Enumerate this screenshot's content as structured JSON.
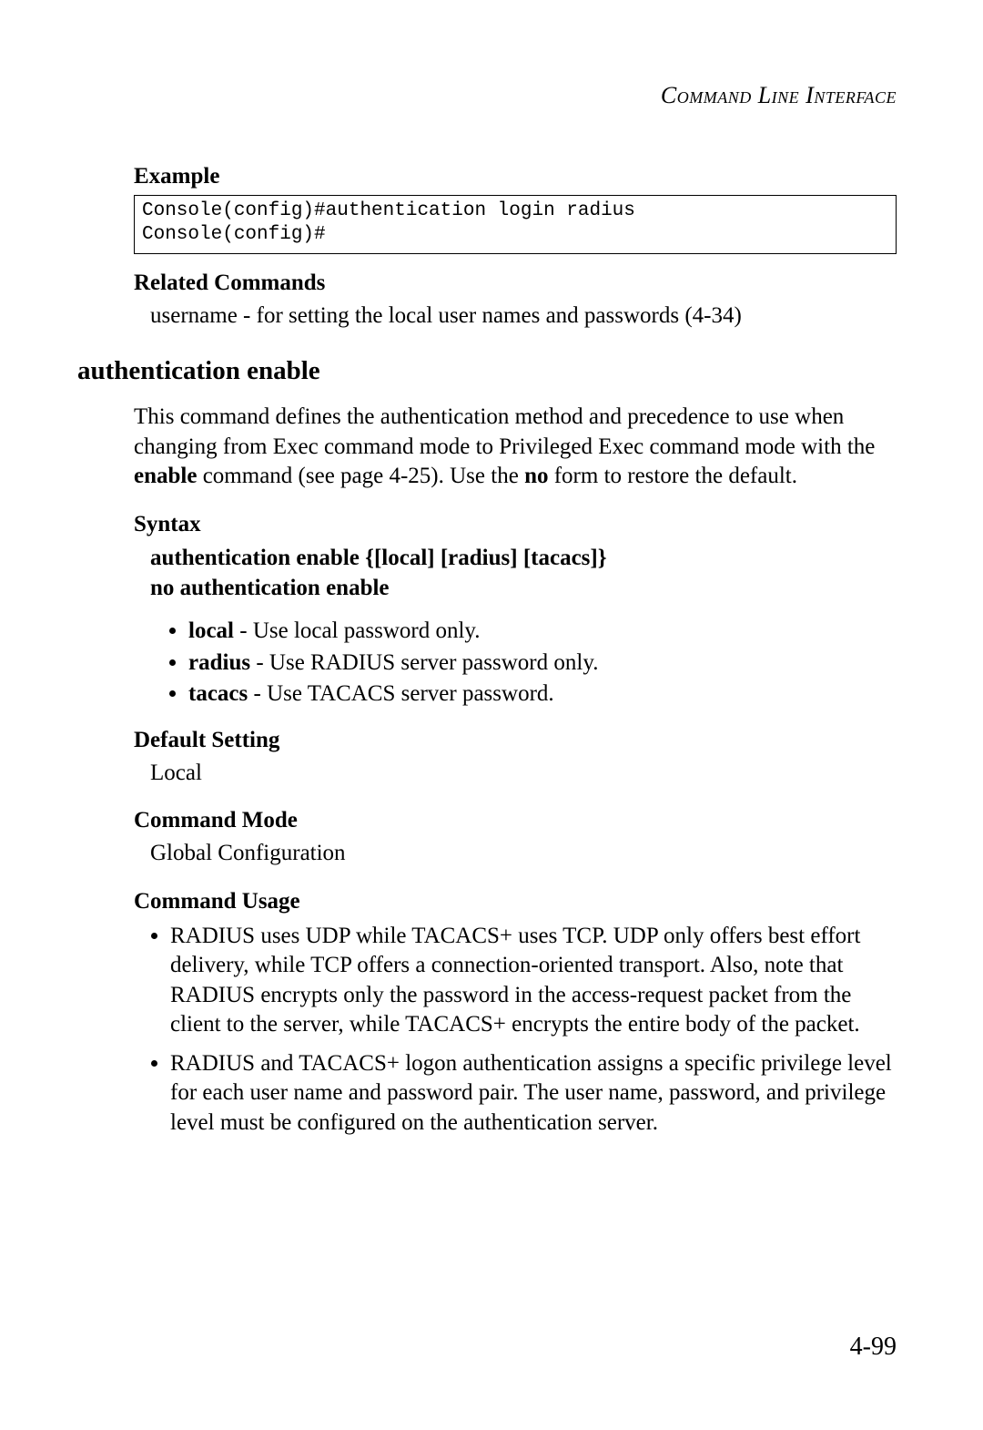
{
  "runningHead": "Command Line Interface",
  "example": {
    "heading": "Example",
    "code": "Console(config)#authentication login radius\nConsole(config)#"
  },
  "related": {
    "heading": "Related Commands",
    "text": "username - for setting the local user names and passwords (4-34)"
  },
  "section": {
    "title": "authentication enable",
    "desc_pre": "This command defines the authentication method and precedence to use when changing from Exec command mode to Privileged Exec command mode with the ",
    "desc_bold1": "enable",
    "desc_mid": " command (see page 4-25). Use the ",
    "desc_bold2": "no",
    "desc_post": " form to restore the default."
  },
  "syntax": {
    "heading": "Syntax",
    "line1": "authentication enable {[local] [radius] [tacacs]}",
    "line2": "no authentication enable",
    "items": {
      "local_b": "local",
      "local_t": " - Use local password only.",
      "radius_b": "radius",
      "radius_t": " - Use RADIUS server password only.",
      "tacacs_b": "tacacs",
      "tacacs_t": " - Use TACACS server password."
    }
  },
  "defaultSetting": {
    "heading": "Default Setting",
    "value": "Local"
  },
  "commandMode": {
    "heading": "Command Mode",
    "value": "Global Configuration"
  },
  "commandUsage": {
    "heading": "Command Usage",
    "item1": "RADIUS uses UDP while TACACS+ uses TCP. UDP only offers best effort delivery, while TCP offers a connection-oriented transport. Also, note that RADIUS encrypts only the password in the access-request packet from the client to the server, while TACACS+ encrypts the entire body of the packet.",
    "item2": "RADIUS and TACACS+ logon authentication assigns a specific privilege level for each user name and password pair. The user name, password, and privilege level must be configured on the authentication server."
  },
  "pageNumber": "4-99"
}
